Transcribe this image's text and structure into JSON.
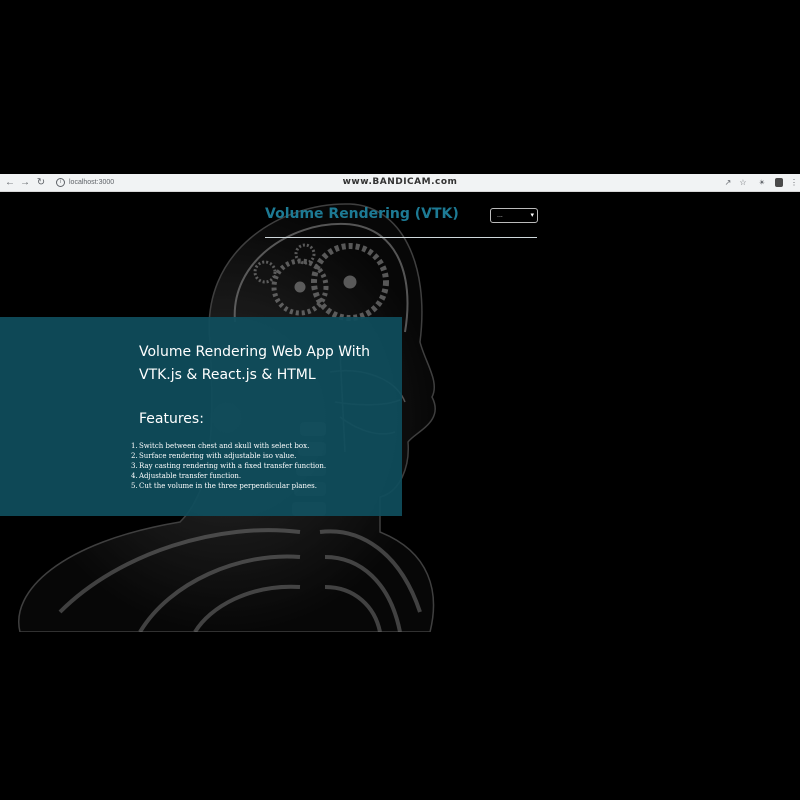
{
  "browser": {
    "url": "localhost:3000",
    "watermark": "www.BANDICAM.com"
  },
  "header": {
    "title": "Volume Rendering (VTK)",
    "select_value": "..."
  },
  "panel": {
    "heading": "Volume Rendering Web App With VTK.js & React.js & HTML",
    "features_title": "Features:",
    "features": [
      {
        "num": "1.",
        "text": "Switch between chest and skull with select box."
      },
      {
        "num": "2.",
        "text": "Surface rendering with adjustable iso value."
      },
      {
        "num": "3.",
        "text": "Ray casting rendering with a fixed transfer function."
      },
      {
        "num": "4.",
        "text": "Adjustable transfer function."
      },
      {
        "num": "5.",
        "text": "Cut the volume in the three perpendicular planes."
      }
    ]
  },
  "colors": {
    "title": "#1d7a94",
    "panel": "#0f4d5c",
    "background": "#000000"
  }
}
